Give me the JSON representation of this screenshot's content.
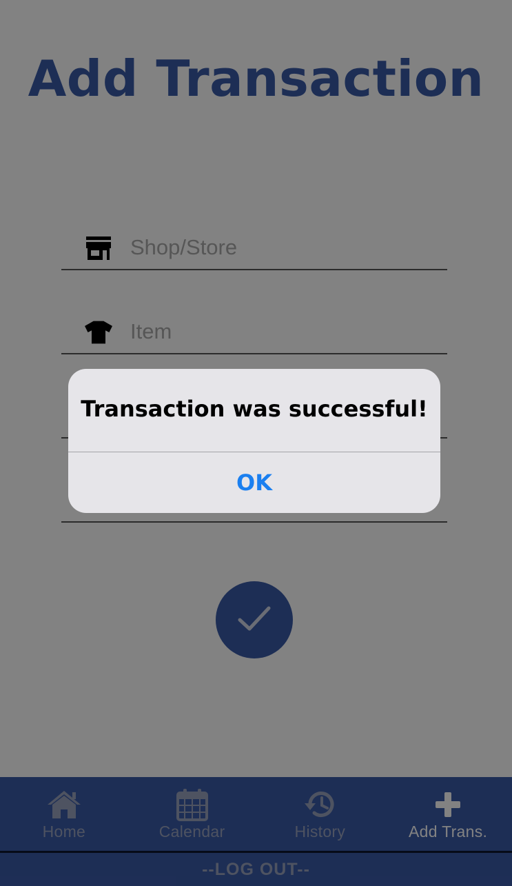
{
  "page": {
    "title": "Add Transaction"
  },
  "form": {
    "shop_placeholder": "Shop/Store",
    "item_placeholder": "Item",
    "field3_placeholder": "",
    "field4_placeholder": ""
  },
  "tabs": [
    {
      "label": "Home",
      "icon": "home-icon",
      "active": false
    },
    {
      "label": "Calendar",
      "icon": "calendar-icon",
      "active": false
    },
    {
      "label": "History",
      "icon": "history-icon",
      "active": false
    },
    {
      "label": "Add Trans.",
      "icon": "plus-icon",
      "active": true
    }
  ],
  "logout": {
    "label": "--LOG OUT--"
  },
  "alert": {
    "message": "Transaction was successful!",
    "ok_label": "OK"
  },
  "colors": {
    "brand": "#3a5aa8",
    "link": "#1a7ff0",
    "overlay": "rgba(0,0,0,0.49)"
  }
}
